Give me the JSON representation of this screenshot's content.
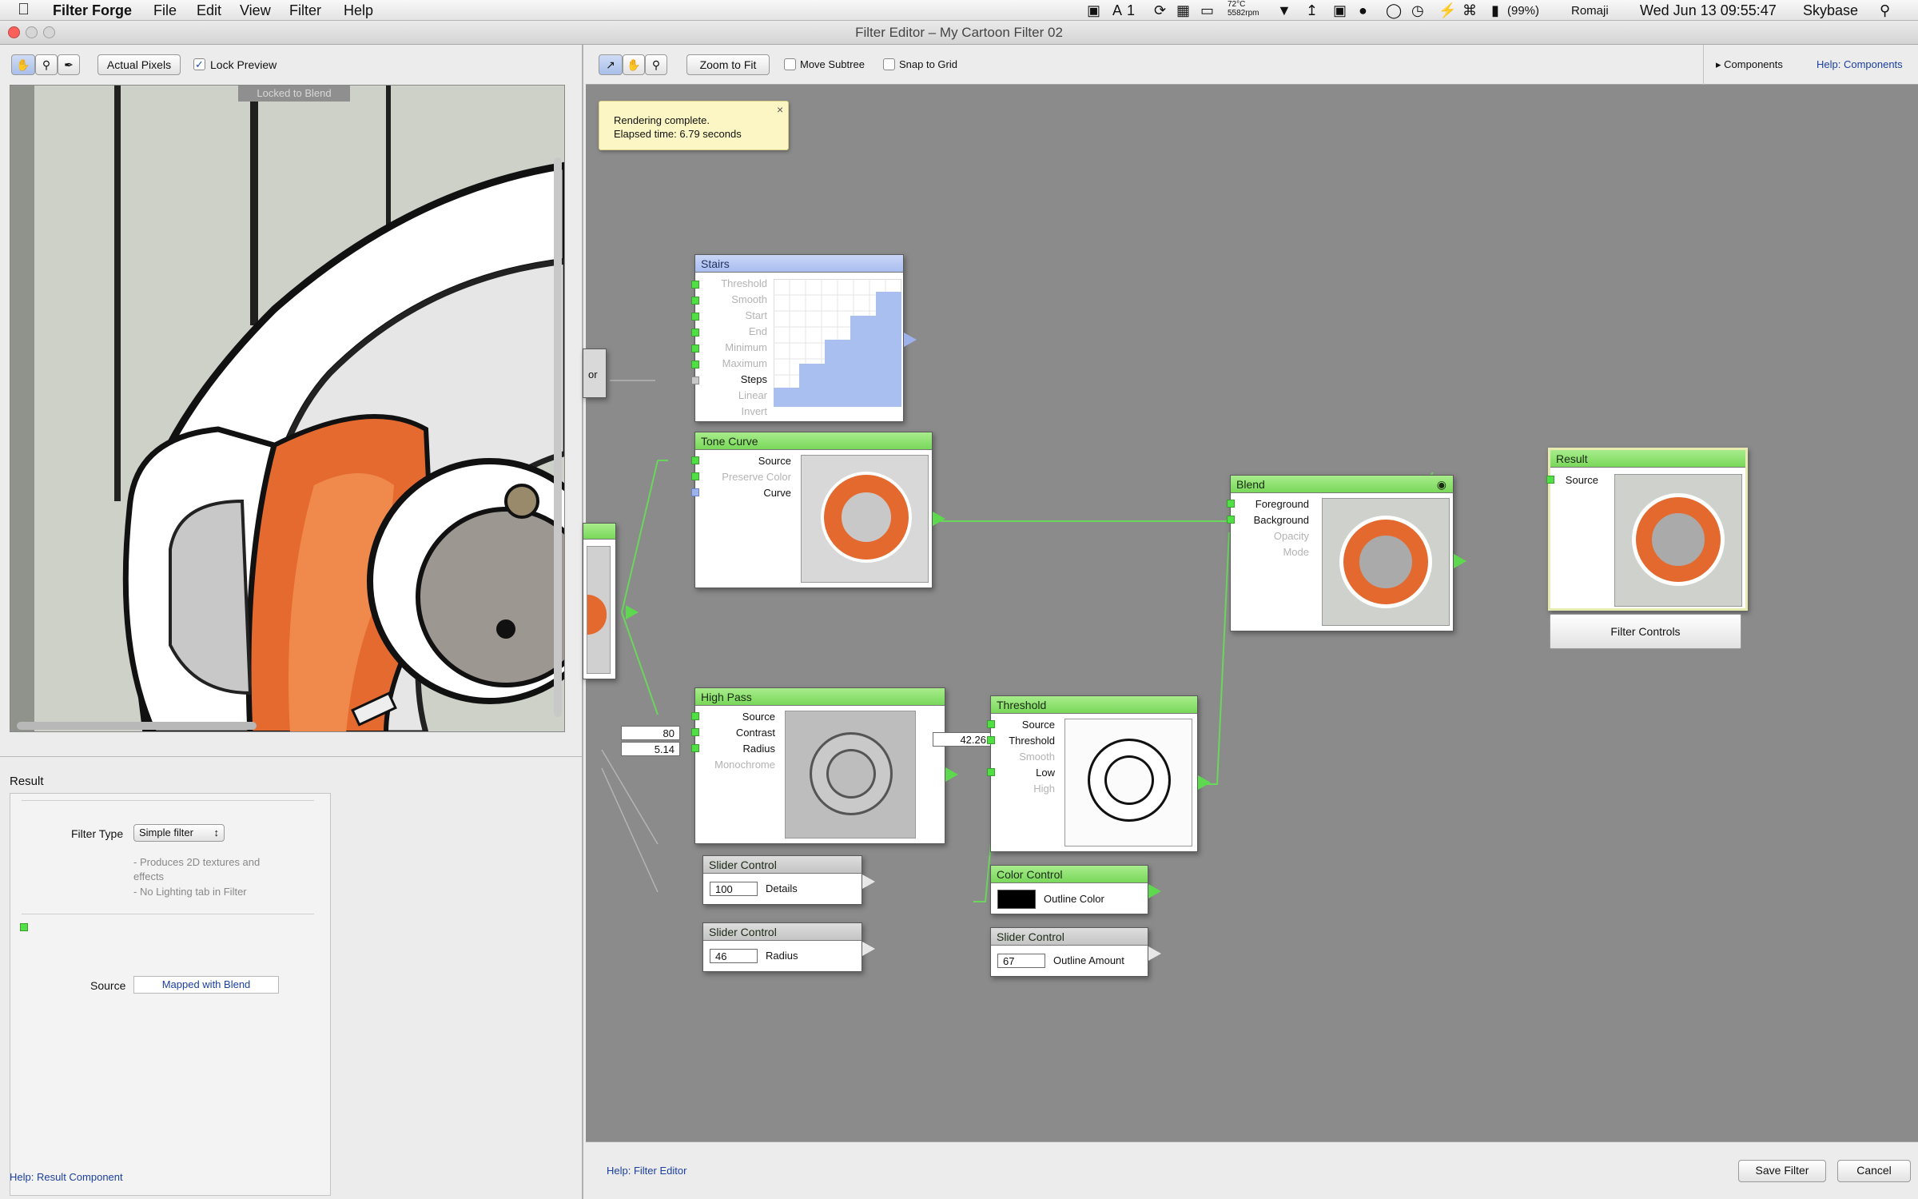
{
  "menubar": {
    "app": "Filter Forge",
    "items": [
      "File",
      "Edit",
      "View",
      "Filter",
      "Help"
    ],
    "ai_label": "1",
    "temp": "72°C",
    "rpm": "5582rpm",
    "battery": "(99%)",
    "ime": "Romaji",
    "clock": "Wed Jun 13  09:55:47",
    "user": "Skybase"
  },
  "window": {
    "title": "Filter Editor – My Cartoon Filter 02"
  },
  "preview_toolbar": {
    "actual_pixels": "Actual Pixels",
    "lock_preview": "Lock Preview",
    "locked_badge": "Locked to Blend"
  },
  "result_panel": {
    "title": "Result",
    "filter_type_label": "Filter Type",
    "filter_type_value": "Simple filter",
    "desc1": "- Produces 2D textures and",
    "desc2": "effects",
    "desc3": "- No Lighting tab in Filter",
    "source_label": "Source",
    "source_value": "Mapped with Blend"
  },
  "left_help": "Help: Result Component",
  "canvas_toolbar": {
    "zoom_fit": "Zoom to Fit",
    "move_subtree": "Move Subtree",
    "snap_grid": "Snap to Grid",
    "components": "Components",
    "help": "Help: Components"
  },
  "toast": {
    "line1": "Rendering complete.",
    "line2": "Elapsed time: 6.79 seconds"
  },
  "nodes": {
    "stairs": {
      "title": "Stairs",
      "ports": [
        "Threshold",
        "Smooth",
        "Start",
        "End",
        "Minimum",
        "Maximum",
        "Steps",
        "Linear",
        "Invert"
      ]
    },
    "tone": {
      "title": "Tone Curve",
      "ports": [
        "Source",
        "Preserve Color",
        "Curve"
      ]
    },
    "blend": {
      "title": "Blend",
      "ports": [
        "Foreground",
        "Background",
        "Opacity",
        "Mode"
      ]
    },
    "result": {
      "title": "Result",
      "port": "Source",
      "controls": "Filter Controls"
    },
    "highpass": {
      "title": "High Pass",
      "ports": [
        "Source",
        "Contrast",
        "Radius",
        "Monochrome"
      ],
      "contrast": "80",
      "radius": "5.14"
    },
    "threshold": {
      "title": "Threshold",
      "ports": [
        "Source",
        "Threshold",
        "Smooth",
        "Low",
        "High"
      ],
      "threshold": "42.26"
    },
    "slider1": {
      "title": "Slider Control",
      "value": "100",
      "label": "Details"
    },
    "slider2": {
      "title": "Slider Control",
      "value": "46",
      "label": "Radius"
    },
    "color": {
      "title": "Color Control",
      "label": "Outline Color",
      "swatch": "#000000"
    },
    "slider3": {
      "title": "Slider Control",
      "value": "67",
      "label": "Outline Amount"
    },
    "partial": {
      "label": "or"
    }
  },
  "bottom": {
    "help": "Help: Filter Editor",
    "save": "Save Filter",
    "cancel": "Cancel"
  },
  "colors": {
    "node_header": "#7fd961",
    "port": "#50df45",
    "canvas": "#8b8b8b",
    "link": "#1b3fa0"
  }
}
